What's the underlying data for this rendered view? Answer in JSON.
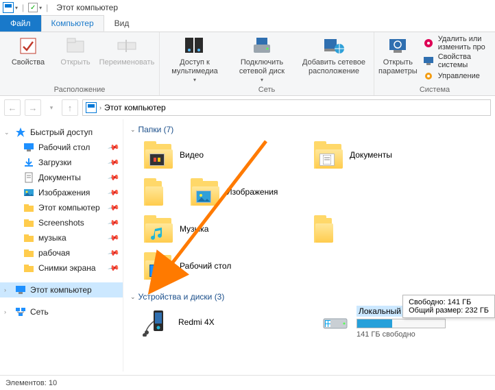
{
  "titlebar": {
    "title": "Этот компьютер"
  },
  "tabs": {
    "file": "Файл",
    "computer": "Компьютер",
    "view": "Вид"
  },
  "ribbon": {
    "location": {
      "properties": "Свойства",
      "open": "Открыть",
      "rename": "Переименовать",
      "group": "Расположение"
    },
    "network": {
      "media": "Доступ к мультимедиа",
      "map_drive": "Подключить сетевой диск",
      "add_location": "Добавить сетевое расположение",
      "group": "Сеть"
    },
    "system": {
      "open_params": "Открыть параметры",
      "remove_program": "Удалить или изменить про",
      "sys_props": "Свойства системы",
      "manage": "Управление",
      "group": "Система"
    }
  },
  "breadcrumb": {
    "label": "Этот компьютер"
  },
  "sidebar": {
    "quick_access": "Быстрый доступ",
    "items": [
      {
        "label": "Рабочий стол",
        "icon": "desktop",
        "pinned": true
      },
      {
        "label": "Загрузки",
        "icon": "downloads",
        "pinned": true
      },
      {
        "label": "Документы",
        "icon": "documents",
        "pinned": true
      },
      {
        "label": "Изображения",
        "icon": "pictures",
        "pinned": true
      },
      {
        "label": "Этот компьютер",
        "icon": "pc",
        "pinned": true
      },
      {
        "label": "Screenshots",
        "icon": "folder",
        "pinned": true
      },
      {
        "label": "музыка",
        "icon": "folder",
        "pinned": true
      },
      {
        "label": "рабочая",
        "icon": "folder",
        "pinned": true
      },
      {
        "label": "Снимки экрана",
        "icon": "folder",
        "pinned": true
      }
    ],
    "this_pc": "Этот компьютер",
    "network": "Сеть"
  },
  "content": {
    "folders_header": "Папки (7)",
    "folders": [
      {
        "label": "Видео",
        "overlay": "video"
      },
      {
        "label": "Документы",
        "overlay": "doc"
      },
      {
        "label": "Изображения",
        "overlay": "image"
      },
      {
        "label": "Музыка",
        "overlay": "music"
      },
      {
        "label": "Рабочий стол",
        "overlay": "desktop"
      }
    ],
    "devices_header": "Устройства и диски (3)",
    "devices": {
      "phone": {
        "label": "Redmi 4X"
      },
      "disk": {
        "label": "Локальный диск (C:)",
        "free_line": "141 ГБ свободно"
      }
    }
  },
  "tooltip": {
    "line1": "Свободно: 141 ГБ",
    "line2": "Общий размер: 232 ГБ"
  },
  "statusbar": {
    "count": "Элементов: 10"
  }
}
